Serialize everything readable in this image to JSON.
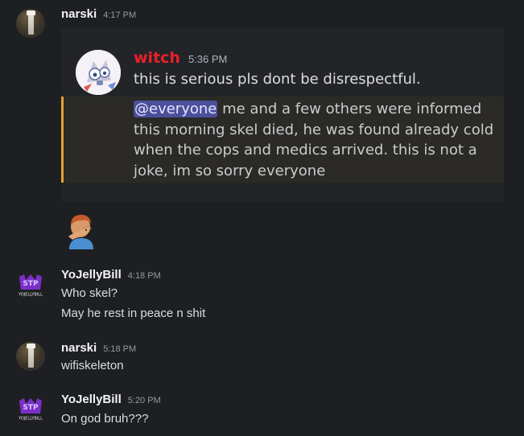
{
  "messages": [
    {
      "username": "narski",
      "time": "4:17 PM",
      "embed": {
        "username": "witch",
        "time": "5:36 PM",
        "line1": "this is serious pls dont be disrespectful.",
        "mention": "@everyone",
        "quote": " me and a few others were informed this morning skel died, he was found already cold when the cops and medics arrived. this is not a joke, im so sorry everyone"
      },
      "emoji": "facepalm-emoji"
    },
    {
      "username": "YoJellyBill",
      "time": "4:18 PM",
      "lines": [
        "Who skel?",
        "May he rest in peace n shit"
      ]
    },
    {
      "username": "narski",
      "time": "5:18 PM",
      "lines": [
        "wifiskeleton"
      ]
    },
    {
      "username": "YoJellyBill",
      "time": "5:20 PM",
      "lines": [
        "On god bruh???"
      ]
    }
  ],
  "colors": {
    "background": "#1e1f22",
    "embed_username": "#e8202a",
    "quote_border": "#e3a232",
    "mention_bg": "#4c4f9a"
  }
}
